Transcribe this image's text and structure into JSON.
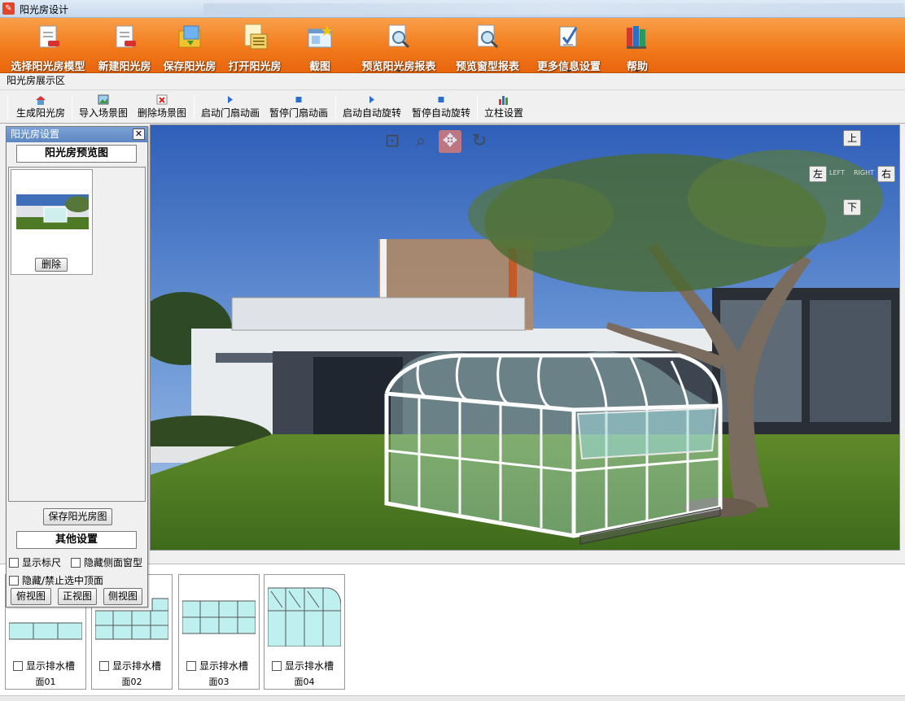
{
  "window": {
    "title": "阳光房设计"
  },
  "ribbon": {
    "items": [
      {
        "label": "选择阳光房模型",
        "icon": "document-select-icon"
      },
      {
        "label": "新建阳光房",
        "icon": "document-new-icon"
      },
      {
        "label": "保存阳光房",
        "icon": "folder-save-icon"
      },
      {
        "label": "打开阳光房",
        "icon": "document-open-icon"
      },
      {
        "label": "截图",
        "icon": "screenshot-icon"
      },
      {
        "label": "预览阳光房报表",
        "icon": "report-preview-icon"
      },
      {
        "label": "预览窗型报表",
        "icon": "window-report-preview-icon"
      },
      {
        "label": "更多信息设置",
        "icon": "edit-settings-icon"
      },
      {
        "label": "帮助",
        "icon": "books-help-icon"
      }
    ]
  },
  "section_label": "阳光房展示区",
  "toolbar": {
    "items": [
      {
        "label": "生成阳光房"
      },
      {
        "label": "导入场景图"
      },
      {
        "label": "删除场景图"
      },
      {
        "label": "启动门扇动画"
      },
      {
        "label": "暂停门扇动画"
      },
      {
        "label": "启动自动旋转"
      },
      {
        "label": "暂停自动旋转"
      },
      {
        "label": "立柱设置"
      }
    ]
  },
  "viewport": {
    "nav": {
      "up": "上",
      "down": "下",
      "left": "左",
      "right": "右",
      "left_hint": "LEFT",
      "right_hint": "RIGHT"
    }
  },
  "panel": {
    "title": "阳光房设置",
    "close": "✕",
    "preview_header": "阳光房预览图",
    "delete_button": "删除",
    "save_button": "保存阳光房图",
    "other_header": "其他设置",
    "options": [
      "显示标尺",
      "隐藏侧面窗型",
      "隐藏/禁止选中顶面"
    ],
    "views": [
      "俯视图",
      "正视图",
      "侧视图"
    ]
  },
  "faces": [
    {
      "checkbox": "显示排水槽",
      "name": "面01"
    },
    {
      "checkbox": "显示排水槽",
      "name": "面02"
    },
    {
      "checkbox": "显示排水槽",
      "name": "面03"
    },
    {
      "checkbox": "显示排水槽",
      "name": "面04"
    }
  ],
  "colors": {
    "ribbon_top": "#f9a04a",
    "ribbon_bottom": "#e8650d",
    "panel_header": "#6e95cc",
    "glass": "#bff0f0"
  }
}
